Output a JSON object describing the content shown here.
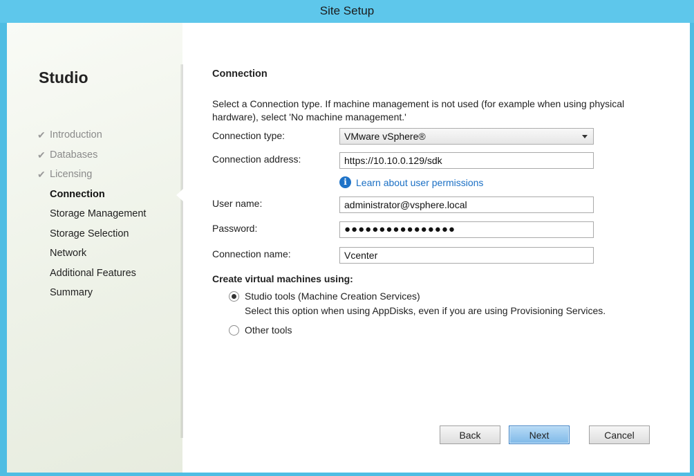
{
  "window": {
    "title": "Site Setup"
  },
  "sidebar": {
    "app_title": "Studio",
    "steps": [
      {
        "label": "Introduction",
        "state": "done"
      },
      {
        "label": "Databases",
        "state": "done"
      },
      {
        "label": "Licensing",
        "state": "done"
      },
      {
        "label": "Connection",
        "state": "current"
      },
      {
        "label": "Storage Management",
        "state": "pending"
      },
      {
        "label": "Storage Selection",
        "state": "pending"
      },
      {
        "label": "Network",
        "state": "pending"
      },
      {
        "label": "Additional Features",
        "state": "pending"
      },
      {
        "label": "Summary",
        "state": "pending"
      }
    ],
    "check_glyph": "✔"
  },
  "content": {
    "section_title": "Connection",
    "description": "Select a Connection type. If machine management is not used (for example when using physical hardware), select 'No machine management.'",
    "connection_type": {
      "label": "Connection type:",
      "value": "VMware vSphere®"
    },
    "connection_address": {
      "label": "Connection address:",
      "value": "https://10.10.0.129/sdk"
    },
    "learn_link": {
      "icon": "info-icon",
      "icon_glyph": "i",
      "text": "Learn about user permissions"
    },
    "user_name": {
      "label": "User name:",
      "value": "administrator@vsphere.local"
    },
    "password": {
      "label": "Password:",
      "value": "●●●●●●●●●●●●●●●●"
    },
    "connection_name": {
      "label": "Connection name:",
      "value": "Vcenter"
    },
    "create_vms": {
      "label": "Create virtual machines using:",
      "options": [
        {
          "label": "Studio tools (Machine Creation Services)",
          "selected": true,
          "hint": "Select this option when using AppDisks, even if you are using Provisioning Services."
        },
        {
          "label": "Other tools",
          "selected": false
        }
      ]
    }
  },
  "buttons": {
    "back": "Back",
    "next": "Next",
    "cancel": "Cancel"
  },
  "colors": {
    "frame": "#5ec7eb",
    "link": "#1a6fc4",
    "primary_button": "#7fb9e8"
  }
}
